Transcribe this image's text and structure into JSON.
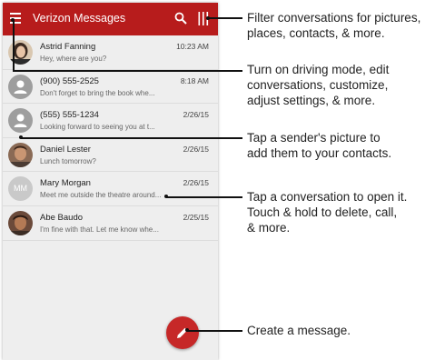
{
  "app": {
    "title": "Verizon Messages",
    "accent_color": "#b71c1c",
    "icons": [
      "menu-icon",
      "search-icon",
      "filter-icon",
      "compose-icon"
    ]
  },
  "conversations": [
    {
      "name": "Astrid Fanning",
      "preview": "Hey, where are you?",
      "time": "10:23 AM",
      "avatar": "photo"
    },
    {
      "name": "(900) 555-2525",
      "preview": "Don't forget to bring the book whe...",
      "time": "8:18 AM",
      "avatar": "person-icon"
    },
    {
      "name": "(555) 555-1234",
      "preview": "Looking forward to seeing you at t...",
      "time": "2/26/15",
      "avatar": "person-icon"
    },
    {
      "name": "Daniel Lester",
      "preview": "Lunch tomorrow?",
      "time": "2/26/15",
      "avatar": "photo"
    },
    {
      "name": "Mary Morgan",
      "preview": "Meet me outside the theatre around...",
      "time": "2/26/15",
      "avatar": "MM"
    },
    {
      "name": "Abe Baudo",
      "preview": "I'm fine with that. Let me know whe...",
      "time": "2/25/15",
      "avatar": "photo"
    }
  ],
  "annotations": {
    "filter": [
      "Filter conversations for pictures,",
      "places, contacts, & more."
    ],
    "menu": [
      "Turn on driving mode, edit",
      "conversations, customize,",
      "adjust settings, & more."
    ],
    "picture": [
      "Tap a sender's picture to",
      "add them to your contacts."
    ],
    "conversation": [
      "Tap  a conversation to open it.",
      "Touch & hold to delete, call,",
      "& more."
    ],
    "compose": [
      "Create a message."
    ]
  }
}
